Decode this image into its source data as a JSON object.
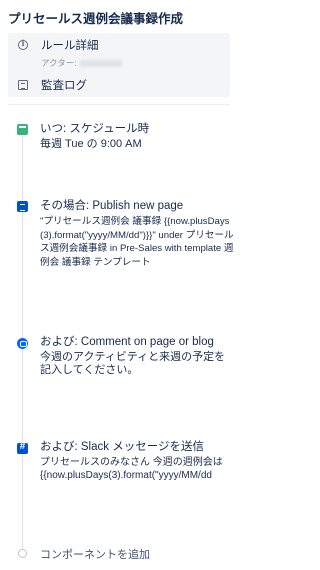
{
  "page": {
    "title": "プリセールス週例会議事録作成"
  },
  "menu": {
    "rule_details": "ルール詳細",
    "actor_label": "アクター:",
    "audit_log": "監査ログ"
  },
  "steps": [
    {
      "head": "いつ: スケジュール時",
      "body": "毎週 Tue の 9:00 AM"
    },
    {
      "head": "その場合: Publish new page",
      "body": "\"プリセールス週例会 議事録 {{now.plusDays(3).format(\"yyyy/MM/dd\")}}\" under プリセールス週例会議事録 in Pre-Sales with template 週例会 議事録 テンプレート"
    },
    {
      "head": "および: Comment on page or blog",
      "body": "今週のアクティビティと来週の予定を記入してください。"
    },
    {
      "head": "および: Slack メッセージを送信",
      "body": "プリセールスのみなさん 今週の週例会は {{now.plusDays(3).format(\"yyyy/MM/dd"
    }
  ],
  "add_component": "コンポーネントを追加"
}
